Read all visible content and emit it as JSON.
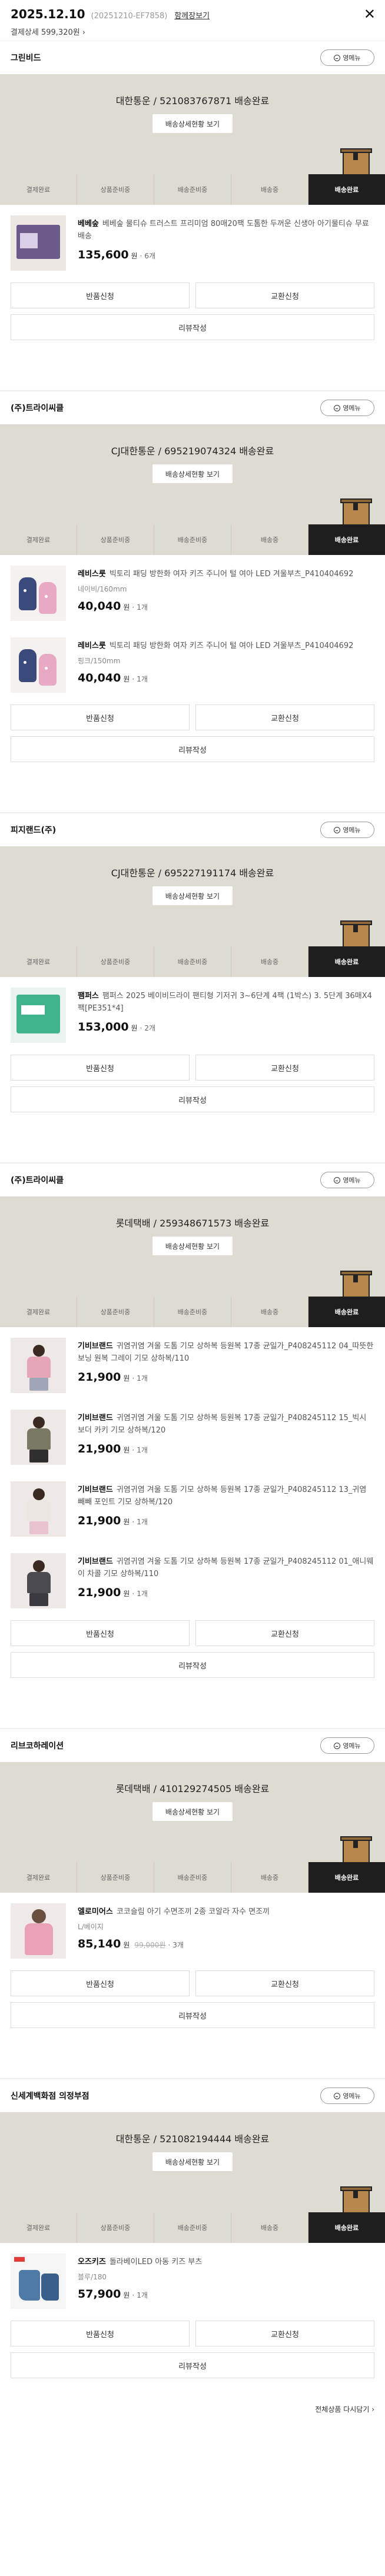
{
  "order": {
    "date": "2025.12.10",
    "order_id": "(20251210-EF7858)",
    "combine_link": "함께장보기",
    "close_glyph": "✕",
    "payment_summary": "결제상세 599,320원",
    "payment_chevron": "›"
  },
  "labels": {
    "contact": "영메뉴",
    "track_btn": "배송상세현황 보기",
    "return": "반품신청",
    "exchange": "교환신청",
    "review": "리뷰작성",
    "qty_suffix": "개",
    "currency": "원",
    "steps": [
      "결제완료",
      "상품준비중",
      "배송준비중",
      "배송중",
      "배송완료"
    ],
    "active_step_index": 4
  },
  "sellers": [
    {
      "name": "그린비드",
      "tracking": "대한통운 / 521083767871 배송완료",
      "items": [
        {
          "brand": "베베숲",
          "title": "베베숲 물티슈 트러스트 프리미엄 80매20팩 도톰한 두꺼운 신생아 아기물티슈 무료배송",
          "option": "",
          "price": "135,600",
          "orig_price": "",
          "qty": "6개",
          "thumb": "t-wipes"
        }
      ]
    },
    {
      "name": "(주)트라이씨클",
      "tracking": "CJ대한통운 / 695219074324 배송완료",
      "items": [
        {
          "brand": "레비스룻",
          "title": "빅토리 패딩 방한화 여자 키즈 주니어 털 여아 LED 겨울부츠_P410404692",
          "option": "네이비/160mm",
          "price": "40,040",
          "orig_price": "",
          "qty": "1개",
          "thumb": "t-shoe"
        },
        {
          "brand": "레비스룻",
          "title": "빅토리 패딩 방한화 여자 키즈 주니어 털 여아 LED 겨울부츠_P410404692",
          "option": "핑크/150mm",
          "price": "40,040",
          "orig_price": "",
          "qty": "1개",
          "thumb": "t-shoe"
        }
      ]
    },
    {
      "name": "피지랜드(주)",
      "tracking": "CJ대한통운 / 695227191174 배송완료",
      "items": [
        {
          "brand": "팸퍼스",
          "title": "팸퍼스 2025 베이비드라이 팬티형 기저귀 3~6단계 4팩 (1박스) 3. 5단계 36매X4팩[PE351*4]",
          "option": "",
          "price": "153,000",
          "orig_price": "",
          "qty": "2개",
          "thumb": "t-diaper"
        }
      ]
    },
    {
      "name": "(주)트라이씨클",
      "tracking": "롯데택배 / 259348671573 배송완료",
      "items": [
        {
          "brand": "기비브랜드",
          "title": "귀염귀염 겨울 도톰 기모 상하복 등원복 17종 균일가_P408245112 04_따뜻한 보닝 원복 그레이 기모 상하복/110",
          "option": "",
          "price": "21,900",
          "orig_price": "",
          "qty": "1개",
          "thumb": "t-kid",
          "body": "#e5a7b8",
          "legs": "#9fa6b5"
        },
        {
          "brand": "기비브랜드",
          "title": "귀염귀염 겨울 도톰 기모 상하복 등원복 17종 균일가_P408245112 15_빅시 보더 카키 기모 상하복/120",
          "option": "",
          "price": "21,900",
          "orig_price": "",
          "qty": "1개",
          "thumb": "t-kid",
          "body": "#7a7a64",
          "legs": "#2f2f2f"
        },
        {
          "brand": "기비브랜드",
          "title": "귀염귀염 겨울 도톰 기모 상하복 등원복 17종 균일가_P408245112 13_귀염 빼빼 포인트 기모 상하복/120",
          "option": "",
          "price": "21,900",
          "orig_price": "",
          "qty": "1개",
          "thumb": "t-kid",
          "body": "#ece6e3",
          "legs": "#e9c3cf"
        },
        {
          "brand": "기비브랜드",
          "title": "귀염귀염 겨울 도톰 기모 상하복 등원복 17종 균일가_P408245112 01_애니웨이 차콜 기모 상하복/110",
          "option": "",
          "price": "21,900",
          "orig_price": "",
          "qty": "1개",
          "thumb": "t-kid",
          "body": "#4a4a50",
          "legs": "#3a3a40"
        }
      ]
    },
    {
      "name": "리브코하레이션",
      "tracking": "롯데택배 / 410129274505 배송완료",
      "items": [
        {
          "brand": "엘로미어스",
          "title": "코코슬림 아기 수면조끼 2종 코알라 자수 면조끼",
          "option": "L/베이지",
          "price": "85,140",
          "orig_price": "99,000원",
          "qty": "3개",
          "thumb": "t-baby"
        }
      ]
    },
    {
      "name": "신세계백화점 의정부점",
      "tracking": "대한통운 / 521082194444 배송완료",
      "items": [
        {
          "brand": "오즈키즈",
          "title": "돌라베이LED 아동 키즈 부츠",
          "option": "블루/180",
          "price": "57,900",
          "orig_price": "",
          "qty": "1개",
          "thumb": "t-boot"
        }
      ]
    }
  ],
  "footer": {
    "reorder": "전체상품 다시담기 ›"
  }
}
